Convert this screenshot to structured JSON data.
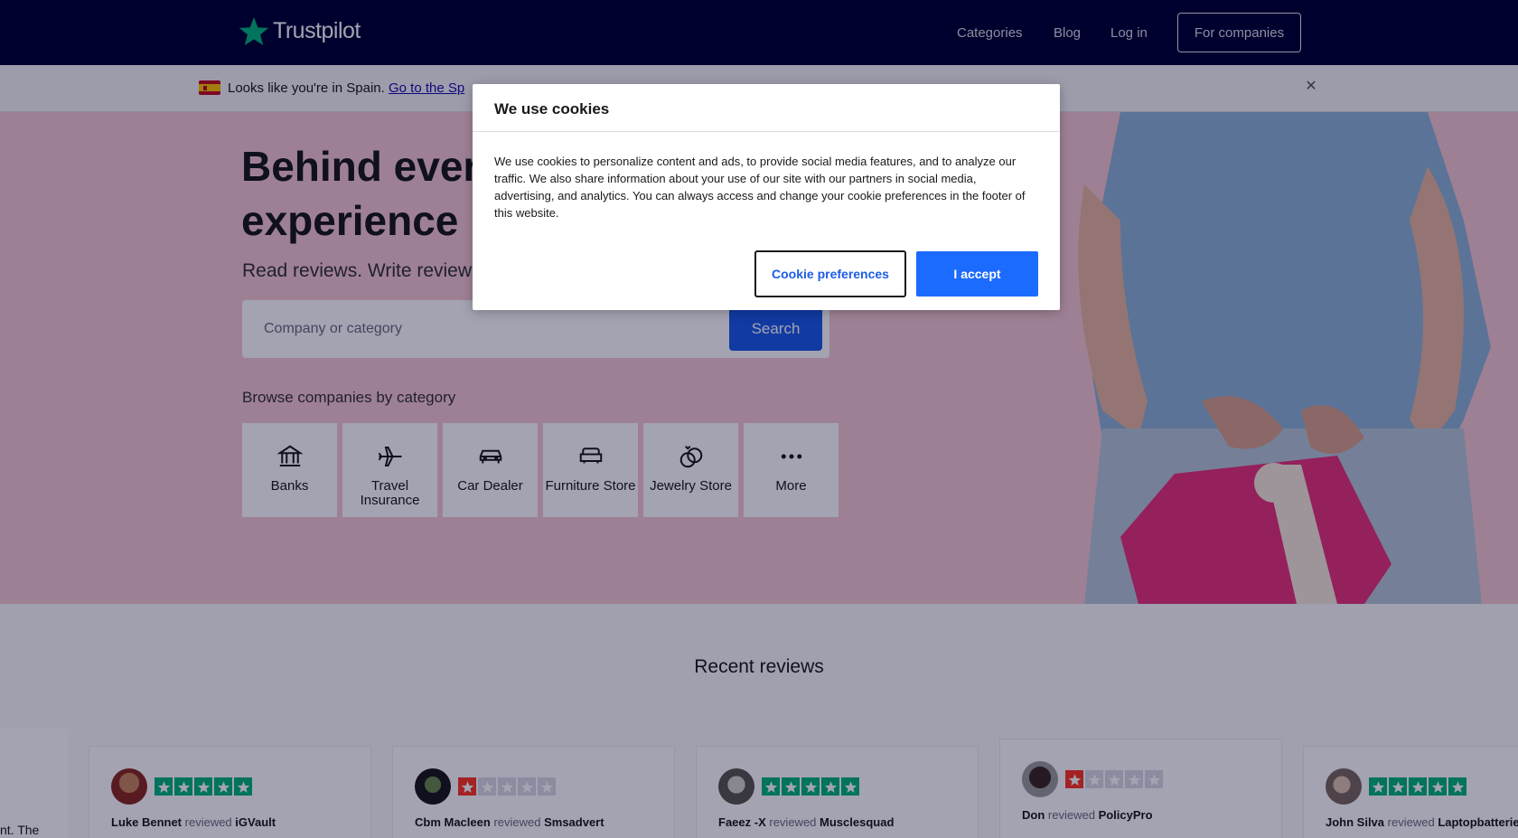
{
  "header": {
    "logo_text": "Trustpilot",
    "nav": {
      "categories": "Categories",
      "blog": "Blog",
      "login": "Log in"
    },
    "for_companies": "For companies",
    "brand_color": "#00b67a",
    "background": "#000032"
  },
  "locale_bar": {
    "text": "Looks like you're in Spain. ",
    "link": "Go to the Sp",
    "close_icon": "close-icon"
  },
  "hero": {
    "title_line1": "Behind ever",
    "title_line2": "experience",
    "subtitle": "Read reviews. Write review",
    "search": {
      "placeholder": "Company or category",
      "button": "Search"
    },
    "browse_title": "Browse companies by category",
    "categories": [
      {
        "label": "Banks",
        "icon": "bank-icon"
      },
      {
        "label": "Travel Insurance",
        "icon": "airplane-icon"
      },
      {
        "label": "Car Dealer",
        "icon": "car-icon"
      },
      {
        "label": "Furniture Store",
        "icon": "sofa-icon"
      },
      {
        "label": "Jewelry Store",
        "icon": "rings-icon"
      },
      {
        "label": "More",
        "icon": "more-icon"
      }
    ]
  },
  "recent_reviews": {
    "title": "Recent reviews",
    "partial_text": "nt. The",
    "cards": [
      {
        "reviewer": "Luke Bennet",
        "reviewed": "reviewed",
        "company": "iGVault",
        "rating": 5
      },
      {
        "reviewer": "Cbm Macleen",
        "reviewed": "reviewed",
        "company": "Smsadvert",
        "rating": 1
      },
      {
        "reviewer": "Faeez -X",
        "reviewed": "reviewed",
        "company": "Musclesquad",
        "rating": 5
      },
      {
        "reviewer": "Don",
        "reviewed": "reviewed",
        "company": "PolicyPro",
        "rating": 1
      },
      {
        "reviewer": "John Silva",
        "reviewed": "reviewed",
        "company": "Laptopbatteries",
        "rating": 5
      }
    ]
  },
  "cookie_modal": {
    "title": "We use cookies",
    "body": "We use cookies to personalize content and ads, to provide social media features, and to analyze our traffic. We also share information about your use of our site with our partners in social media, advertising, and analytics. You can always access and change your cookie preferences in the footer of this website.",
    "preferences_button": "Cookie preferences",
    "accept_button": "I accept",
    "accent_color": "#1c6bff"
  },
  "colors": {
    "star_green": "#00b67a",
    "star_red": "#ff3722",
    "star_empty": "#dcdce6"
  }
}
